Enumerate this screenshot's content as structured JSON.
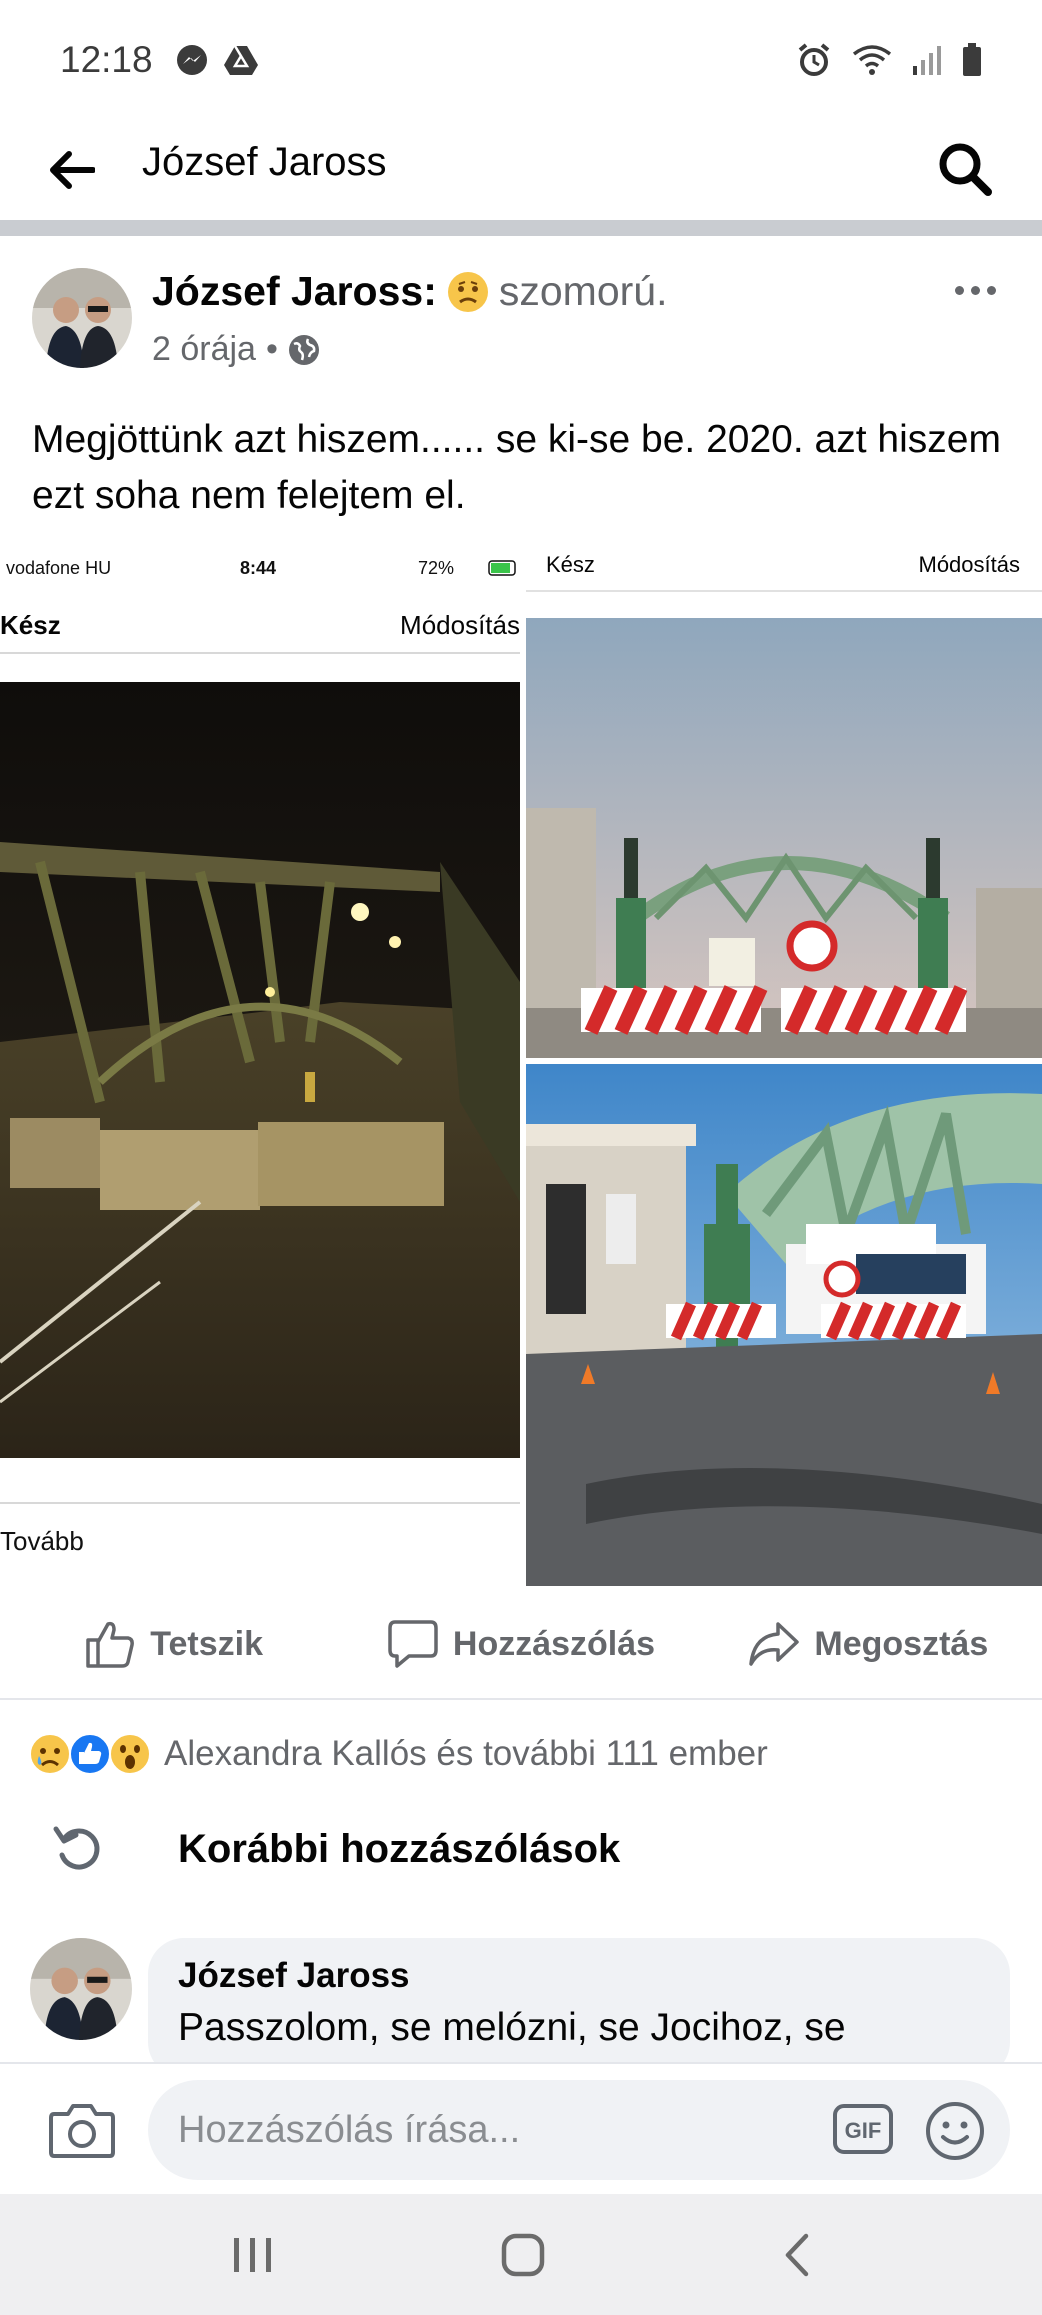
{
  "status_bar": {
    "time": "12:18"
  },
  "header": {
    "title": "József Jaross"
  },
  "post": {
    "author": "József Jaross",
    "colon": ":",
    "feeling": "szomorú.",
    "time": "2 órája",
    "dot": "•",
    "text": "Megjöttünk azt hiszem...... se ki-se be. 2020. azt hiszem ezt soha nem felejtem el."
  },
  "photo_left": {
    "carrier": "vodafone HU",
    "time": "8:44",
    "battery": "72%",
    "done": "Kész",
    "edit": "Módosítás",
    "more": "Tovább"
  },
  "photo_right_top": {
    "done": "Kész",
    "edit": "Módosítás"
  },
  "actions": {
    "like": "Tetszik",
    "comment": "Hozzászólás",
    "share": "Megosztás"
  },
  "reactions": {
    "text": "Alexandra Kallós és további 111 ember"
  },
  "comments": {
    "previous_label": "Korábbi hozzászólások",
    "items": [
      {
        "author": "József Jaross",
        "text": "Passzolom, se melózni, se Jocihoz, se"
      }
    ]
  },
  "composer": {
    "placeholder": "Hozzászólás írása..."
  },
  "colors": {
    "accent": "#1877f2",
    "secondary_text": "#65676b",
    "bubble": "#f0f2f5"
  }
}
